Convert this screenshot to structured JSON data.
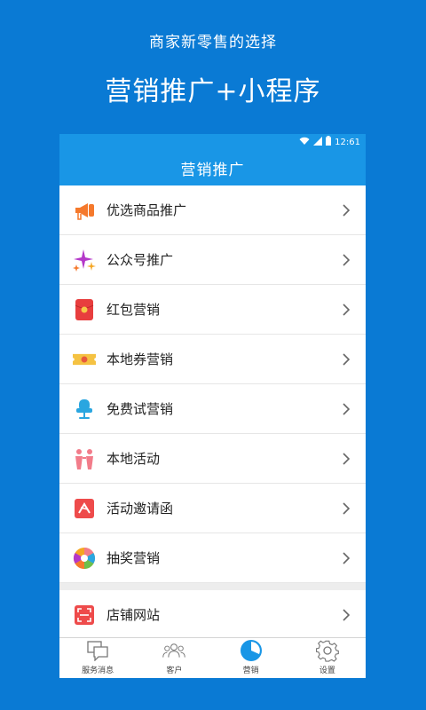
{
  "promo": {
    "subtitle": "商家新零售的选择",
    "title": "营销推广+小程序"
  },
  "status_bar": {
    "time": "12:61",
    "icons": [
      "wifi-icon",
      "signal-icon",
      "battery-icon"
    ]
  },
  "app_bar": {
    "title": "营销推广"
  },
  "menu": {
    "items": [
      {
        "label": "优选商品推广",
        "icon": "megaphone-icon"
      },
      {
        "label": "公众号推广",
        "icon": "sparkle-icon"
      },
      {
        "label": "红包营销",
        "icon": "red-envelope-icon"
      },
      {
        "label": "本地券营销",
        "icon": "coupon-icon"
      },
      {
        "label": "免费试营销",
        "icon": "chair-icon"
      },
      {
        "label": "本地活动",
        "icon": "people-icon"
      },
      {
        "label": "活动邀请函",
        "icon": "invitation-icon"
      },
      {
        "label": "抽奖营销",
        "icon": "prize-wheel-icon"
      }
    ],
    "extra_items": [
      {
        "label": "店铺网站",
        "icon": "scan-frame-icon"
      }
    ]
  },
  "tab_bar": {
    "tabs": [
      {
        "label": "服务消息",
        "icon": "chat-icon",
        "active": false
      },
      {
        "label": "客户",
        "icon": "customers-icon",
        "active": false
      },
      {
        "label": "营销",
        "icon": "pie-chart-icon",
        "active": true
      },
      {
        "label": "设置",
        "icon": "gear-icon",
        "active": false
      }
    ]
  },
  "colors": {
    "background": "#0A7AD4",
    "app_bar": "#1996E6",
    "active_tab": "#1996E6"
  }
}
